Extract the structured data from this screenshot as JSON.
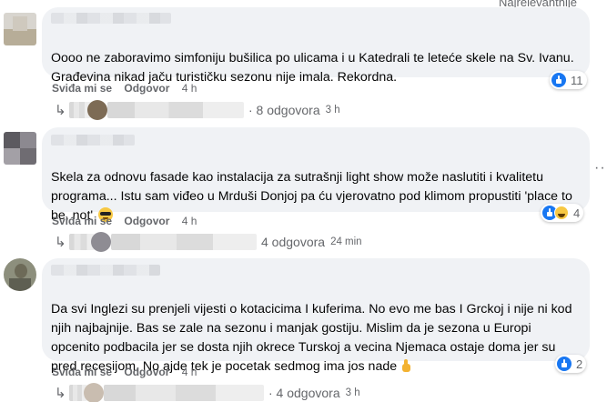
{
  "header": {
    "sort_label": "Najrelevantnije"
  },
  "more_options_glyph": "···",
  "comments": [
    {
      "text": "Oooo ne zaboravimo simfoniju bušilica po ulicama i u Katedrali te leteće skele na Sv. Ivanu. Građevina nikad jaču turističku sezonu nije imala. Rekordna.",
      "emoji": "",
      "actions": {
        "like": "Sviđa mi se",
        "reply": "Odgovor",
        "time": "4 h"
      },
      "reactions": {
        "icons": [
          "like"
        ],
        "count": "11"
      },
      "replies": {
        "label": "· 8 odgovora",
        "time": "3 h"
      }
    },
    {
      "text": "Skela za odnovu fasade kao instalacija za sutrašnji light show može naslutiti i kvalitetu programa... Istu sam viđeo u Mrduši Donjoj pa ću vjerovatno pod klimom propustiti 'place to be, not' ",
      "emoji": "sunglasses",
      "actions": {
        "like": "Sviđa mi se",
        "reply": "Odgovor",
        "time": "4 h"
      },
      "reactions": {
        "icons": [
          "like",
          "haha"
        ],
        "count": "4"
      },
      "replies": {
        "label": "4 odgovora",
        "time": "24 min"
      }
    },
    {
      "text": "Da svi Inglezi su prenjeli vijesti o kotacicima I kuferima. No evo me bas I Grckoj i nije ni kod njih najbajnije. Bas se zale na sezonu i manjak gostiju. Mislim da je sezona u Europi opcenito podbacila jer se dosta njih okrece Turskoj a vecina Njemaca ostaje doma jer su pred recesijom. No ajde tek je pocetak sedmog ima jos nade",
      "emoji": "thumb",
      "actions": {
        "like": "Sviđa mi se",
        "reply": "Odgovor",
        "time": "4 h"
      },
      "reactions": {
        "icons": [
          "like"
        ],
        "count": "2"
      },
      "replies": {
        "label": "· 4 odgovora",
        "time": "3 h"
      }
    }
  ],
  "colors": {
    "bubble": "#f0f2f5",
    "muted": "#65676b",
    "like_blue": "#1877f2"
  }
}
